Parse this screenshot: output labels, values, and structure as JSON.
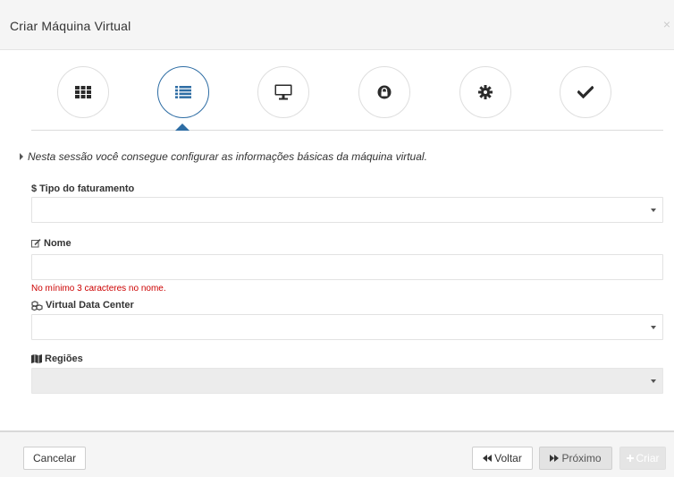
{
  "modal": {
    "title": "Criar Máquina Virtual",
    "close_symbol": "×"
  },
  "wizard": {
    "steps": [
      {
        "icon": "grid-icon",
        "active": false
      },
      {
        "icon": "list-icon",
        "active": true
      },
      {
        "icon": "monitor-icon",
        "active": false
      },
      {
        "icon": "lock-icon",
        "active": false
      },
      {
        "icon": "gear-icon",
        "active": false
      },
      {
        "icon": "checkmark-icon",
        "active": false
      }
    ],
    "accent_color": "#2e6da4"
  },
  "intro_text": "Nesta sessão você consegue configurar as informações básicas da máquina virtual.",
  "form": {
    "billing_type": {
      "label": "Tipo do faturamento",
      "icon": "dollar-icon",
      "icon_glyph": "$",
      "value": ""
    },
    "name": {
      "label": "Nome",
      "icon": "edit-icon",
      "value": "",
      "error": "No mínimo 3 caracteres no nome."
    },
    "vdc": {
      "label": "Virtual Data Center",
      "icon": "cubes-icon",
      "value": ""
    },
    "regions": {
      "label": "Regiões",
      "icon": "map-icon",
      "value": "",
      "disabled": true
    }
  },
  "footer": {
    "cancel_label": "Cancelar",
    "back_label": "Voltar",
    "next_label": "Próximo",
    "create_label": "Criar"
  },
  "colors": {
    "error": "#cc0000"
  }
}
